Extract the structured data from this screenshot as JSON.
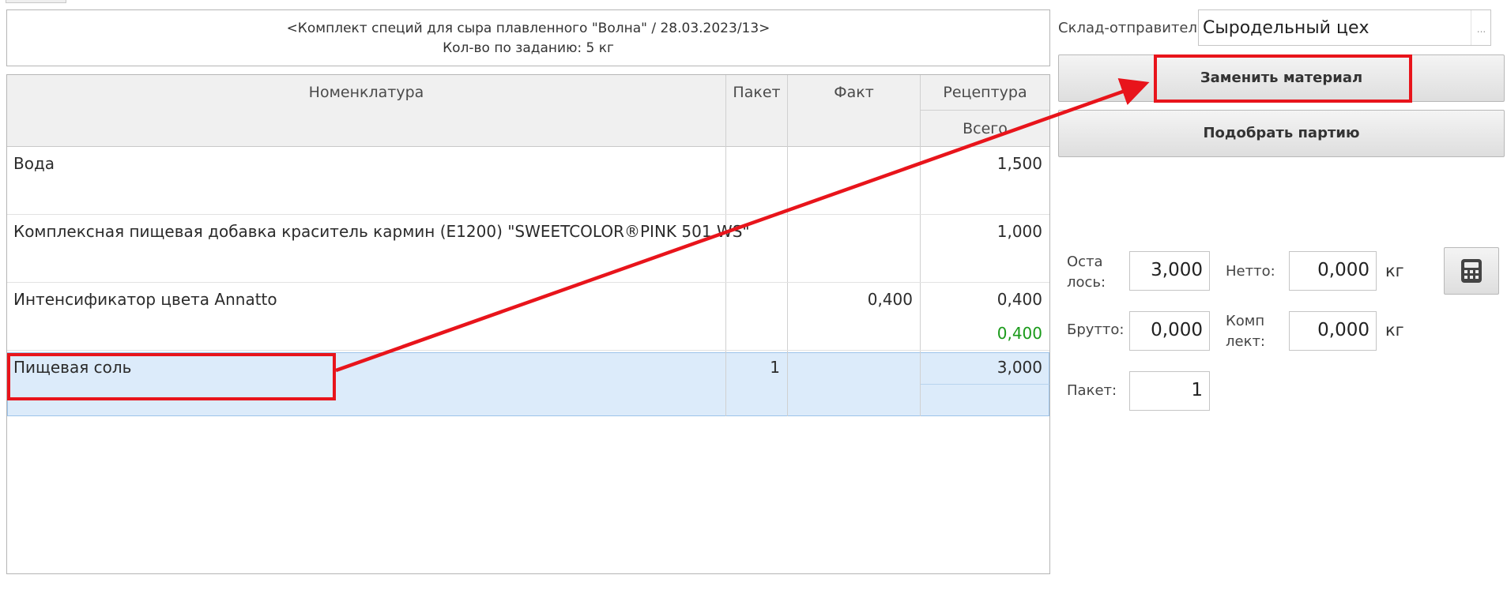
{
  "header": {
    "doc_title": "<Комплект специй для сыра плавленного \"Волна\" / 28.03.2023/13>",
    "qty_line": "Кол-во по заданию: 5 кг"
  },
  "table": {
    "columns": {
      "nomenclature": "Номенклатура",
      "packet": "Пакет",
      "fact": "Факт",
      "recipe": "Рецептура",
      "recipe_total": "Всего"
    },
    "rows": [
      {
        "name": "Вода",
        "packet": "",
        "fact": "",
        "total": "1,500",
        "sub": ""
      },
      {
        "name": "Комплексная пищевая добавка краситель кармин (Е1200) \"SWEETCOLOR®PINK 501 WS\"",
        "packet": "",
        "fact": "",
        "total": "1,000",
        "sub": ""
      },
      {
        "name": "Интенсификатор цвета Annatto",
        "packet": "",
        "fact": "0,400",
        "total": "0,400",
        "sub": "0,400"
      },
      {
        "name": "Пищевая соль",
        "packet": "1",
        "fact": "",
        "total": "3,000",
        "sub": ""
      }
    ]
  },
  "panel": {
    "warehouse_label": "Склад-отправитель:",
    "warehouse_value": "Сыродельный цех",
    "warehouse_btn": "...",
    "replace_btn": "Заменить материал",
    "pick_btn": "Подобрать партию",
    "remaining_label_1": "Оста",
    "remaining_label_2": "лось:",
    "remaining_value": "3,000",
    "netto_label": "Нетто:",
    "netto_value": "0,000",
    "netto_unit": "кг",
    "brutto_label": "Брутто:",
    "brutto_value": "0,000",
    "kit_label_1": "Комп",
    "kit_label_2": "лект:",
    "kit_value": "0,000",
    "kit_unit": "кг",
    "packet_label": "Пакет:",
    "packet_value": "1"
  },
  "colors": {
    "annotation": "#e8141b",
    "selection": "#dcebfa",
    "green_value": "#1a9a1a"
  },
  "icons": {
    "calculator": "calculator-icon"
  }
}
